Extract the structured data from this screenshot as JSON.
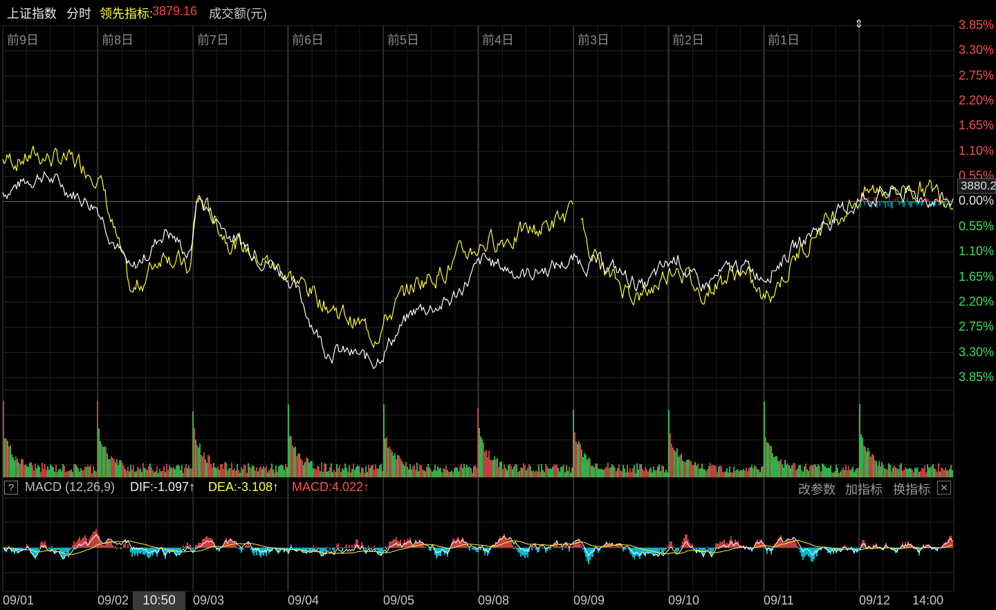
{
  "header": {
    "index_name": "上证指数",
    "mode": "分时",
    "leading_label": "领先指标:",
    "leading_value": "3879.16",
    "volume_label": "成交额(元)"
  },
  "day_labels": [
    "前9日",
    "前8日",
    "前7日",
    "前6日",
    "前5日",
    "前4日",
    "前3日",
    "前2日",
    "前1日"
  ],
  "y_labels_up": [
    "3.85%",
    "3.30%",
    "2.75%",
    "2.20%",
    "1.65%",
    "1.10%",
    "0.55%"
  ],
  "y_label_zero": "0.00%",
  "y_labels_down": [
    "0.55%",
    "1.10%",
    "1.65%",
    "2.20%",
    "2.75%",
    "3.30%",
    "3.85%"
  ],
  "price_tag": "3880.2",
  "macd": {
    "help": "?",
    "title": "MACD (12,26,9)",
    "dif": "DIF:-1.097↑",
    "dea": "DEA:-3.108↑",
    "macd": "MACD:4.022↑",
    "actions": [
      "改参数",
      "加指标",
      "换指标"
    ],
    "close": "✕"
  },
  "x_labels": [
    "09/01",
    "09/02",
    "09/03",
    "09/04",
    "09/05",
    "09/08",
    "09/09",
    "09/10",
    "09/11",
    "09/12",
    "14:00"
  ],
  "cursor_time": "10:50",
  "colors": {
    "up": "#f05050",
    "down": "#3ddc5a",
    "yellow": "#ffff33",
    "cyan": "#00e8ff",
    "white": "#ffffff",
    "grid": "#2a2a2a"
  },
  "icons": {
    "drag_handle": "up-down-arrow-icon"
  }
}
